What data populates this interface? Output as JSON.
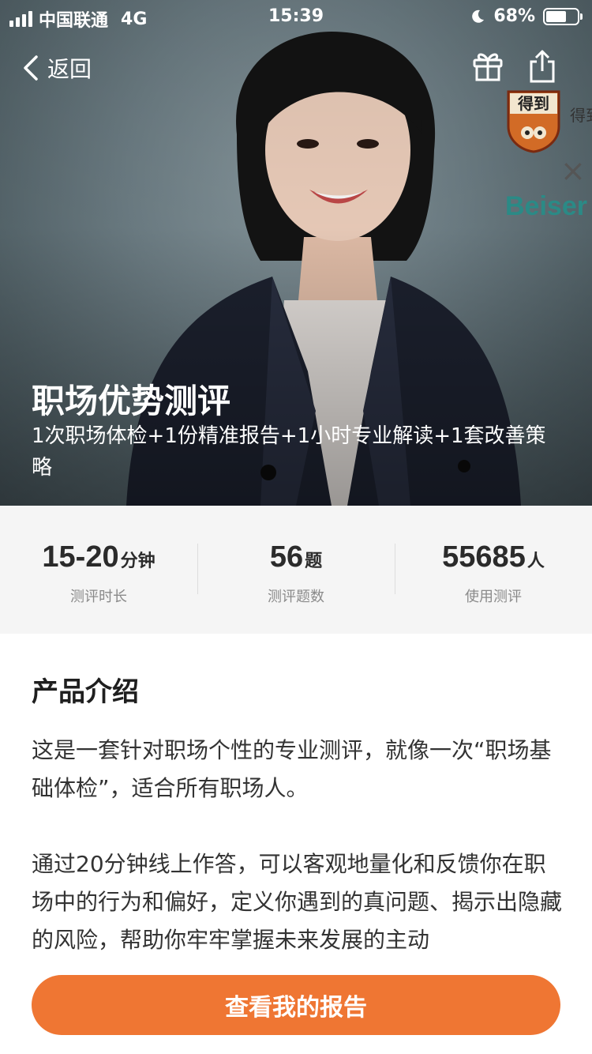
{
  "status_bar": {
    "carrier": "中国联通",
    "network": "4G",
    "time": "15:39",
    "battery": "68%",
    "battery_level": 0.68
  },
  "nav": {
    "back_label": "返回",
    "gift_icon": "gift-icon",
    "share_icon": "share-icon"
  },
  "hero": {
    "brand_logo_text": "得到",
    "brand_side_text": "得到",
    "cross": "×",
    "partner_text": "Beiser",
    "title": "职场优势测评",
    "subtitle": "1次职场体检+1份精准报告+1小时专业解读+1套改善策略"
  },
  "stats": [
    {
      "value": "15-20",
      "unit": "分钟",
      "label": "测评时长"
    },
    {
      "value": "56",
      "unit": "题",
      "label": "测评题数"
    },
    {
      "value": "55685",
      "unit": "人",
      "label": "使用测评"
    }
  ],
  "intro": {
    "title": "产品介绍",
    "paragraphs": [
      "这是一套针对职场个性的专业测评，就像一次“职场基础体检”，适合所有职场人。",
      "通过20分钟线上作答，可以客观地量化和反馈你在职场中的行为和偏好，定义你遇到的真问题、揭示出隐藏的风险，帮助你牢牢掌握未来发展的主动"
    ]
  },
  "cta": {
    "label": "查看我的报告"
  },
  "colors": {
    "accent": "#ef7633",
    "stats_bg": "#f5f5f5",
    "partner": "#2b8a86"
  }
}
